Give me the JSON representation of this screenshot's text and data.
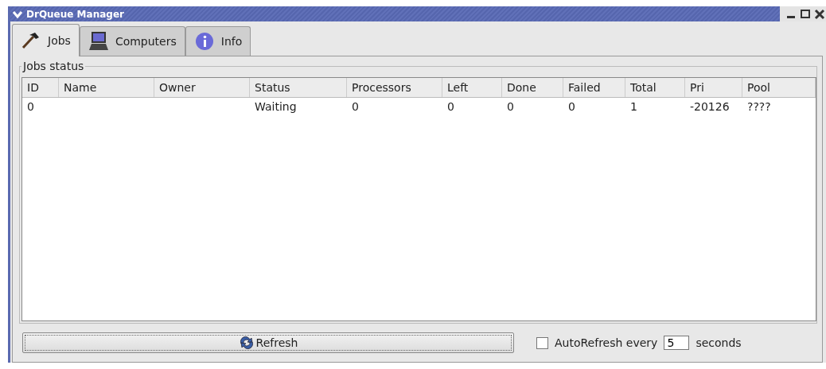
{
  "window": {
    "title": "DrQueue Manager"
  },
  "tabs": [
    {
      "label": "Jobs",
      "selected": true
    },
    {
      "label": "Computers",
      "selected": false
    },
    {
      "label": "Info",
      "selected": false
    }
  ],
  "group": {
    "title": "Jobs status"
  },
  "table": {
    "columns": [
      "ID",
      "Name",
      "Owner",
      "Status",
      "Processors",
      "Left",
      "Done",
      "Failed",
      "Total",
      "Pri",
      "Pool"
    ],
    "rows": [
      [
        "0",
        "",
        "",
        "Waiting",
        "0",
        "0",
        "0",
        "0",
        "1",
        "-20126",
        "????"
      ]
    ]
  },
  "refresh_button": {
    "label": "Refresh"
  },
  "auto_refresh": {
    "label": "AutoRefresh every",
    "checked": false,
    "value": "5",
    "unit": "seconds"
  }
}
